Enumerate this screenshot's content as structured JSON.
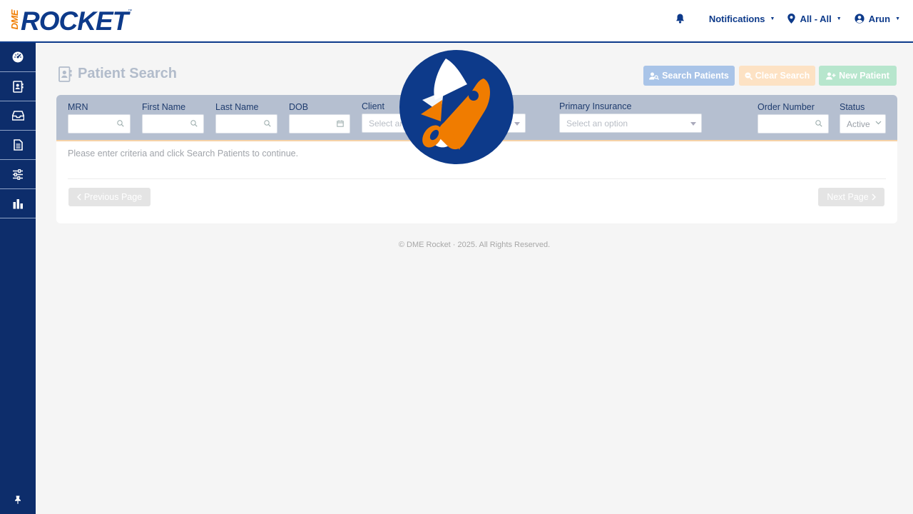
{
  "header": {
    "logo_prefix": "DME",
    "logo_text": "ROCKET",
    "logo_tm": "™",
    "notifications_label": "Notifications",
    "location_label": "All - All",
    "user_label": "Arun"
  },
  "page": {
    "title": "Patient Search"
  },
  "actions": {
    "search_label": "Search Patients",
    "clear_label": "Clear Search",
    "new_label": "New Patient"
  },
  "filters": {
    "mrn_label": "MRN",
    "first_name_label": "First Name",
    "last_name_label": "Last Name",
    "dob_label": "DOB",
    "client_label": "Client",
    "client_placeholder": "Select an option",
    "primary_insurance_label": "Primary Insurance",
    "primary_insurance_placeholder": "Select an option",
    "order_number_label": "Order Number",
    "status_label": "Status",
    "status_value": "Active"
  },
  "results": {
    "message": "Please enter criteria and click Search Patients to continue.",
    "prev_label": "Previous Page",
    "next_label": "Next Page"
  },
  "footer": {
    "text": "© DME Rocket  ·  2025. All Rights Reserved."
  },
  "colors": {
    "brand_blue": "#0d3a8a",
    "brand_orange": "#f07c00",
    "sidebar": "#0d2d6b"
  },
  "icons": {
    "sidebar": [
      "dashboard-icon",
      "patient-card-icon",
      "inbox-icon",
      "document-icon",
      "sliders-icon",
      "bar-chart-icon"
    ],
    "pin": "pin-icon"
  }
}
